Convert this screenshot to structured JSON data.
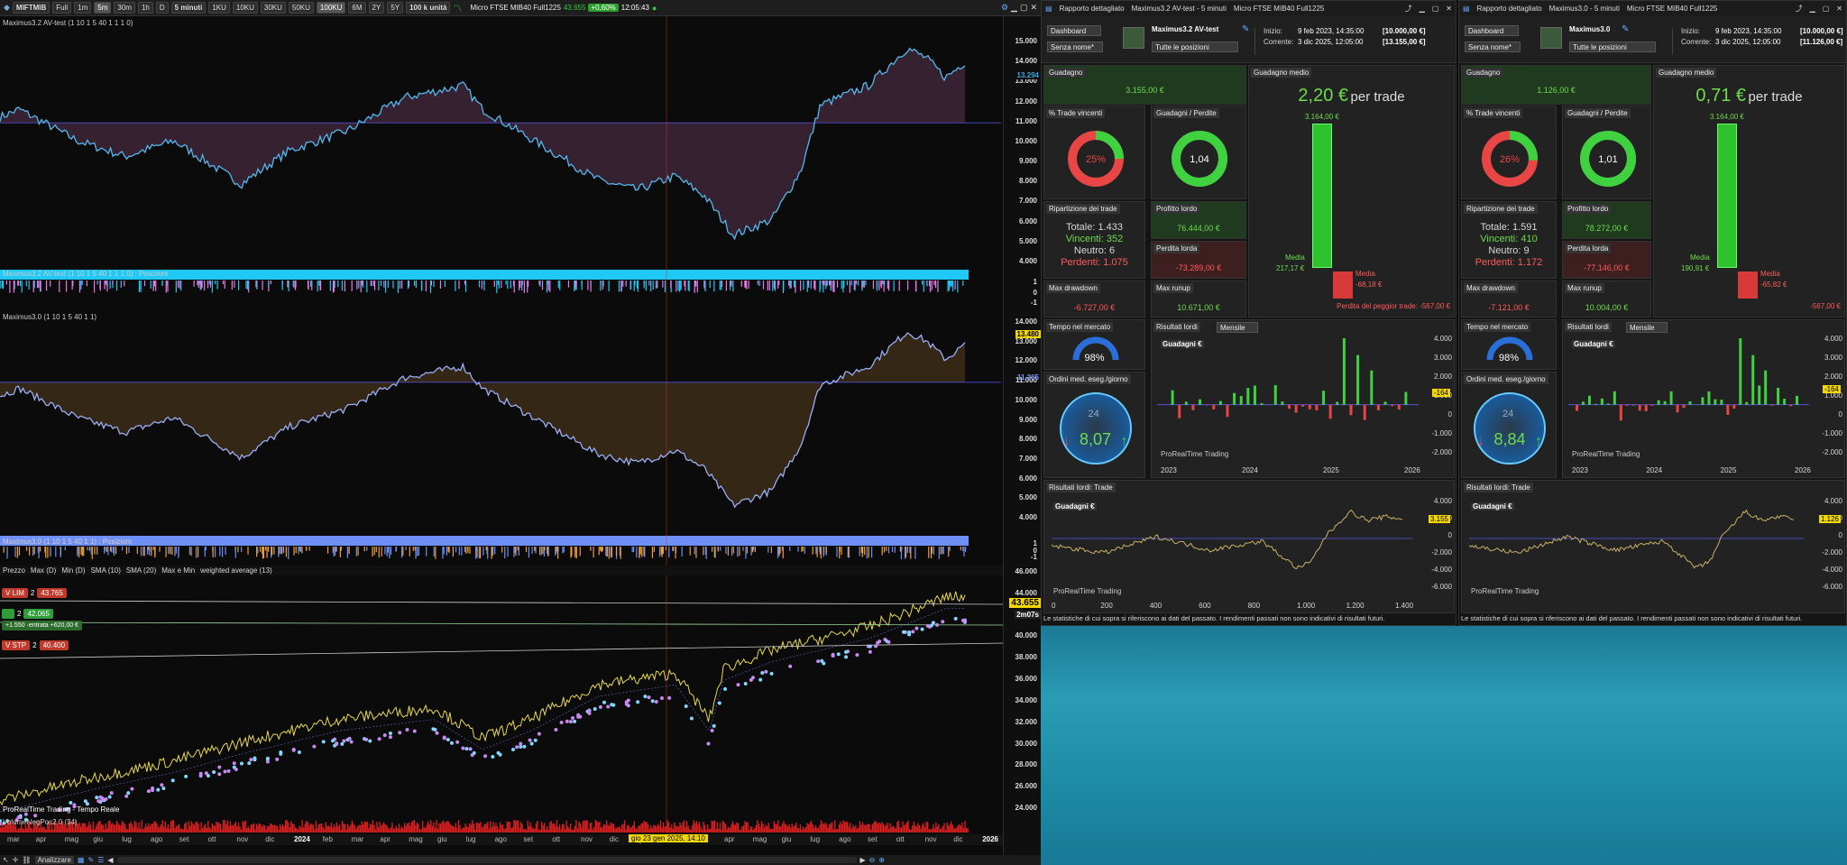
{
  "toolbar": {
    "symbol": "MIFTMIB",
    "full": "Full",
    "tf_buttons": [
      "1m",
      "5m",
      "30m",
      "1h",
      "D"
    ],
    "interval": "5 minuti",
    "range_buttons": [
      "1KU",
      "10KU",
      "30KU",
      "50KU",
      "100KU",
      "6M",
      "2Y",
      "5Y"
    ],
    "units": "100 k unità",
    "instrument": "Micro FTSE MIB40 Full1225",
    "price": "43.655",
    "change": "+0,60%",
    "time": "12:05:43"
  },
  "colors": {
    "cyan": "#00bfff",
    "violet": "#b066c8",
    "orange": "#e89a2a",
    "periwinkle": "#7d9cff",
    "yellow": "#e8d84a",
    "green": "#3fd13f",
    "red": "#e03030"
  },
  "panels": {
    "p1_label": "Maximus3.2 AV-test (1 10 1 5 40 1 1 1 0)",
    "p1_pos_label": "Maximus3.2 AV-test (1 10 1 5 40 1 1 1 0) : Posizioni",
    "p2_label": "Maximus3.0 (1 10 1 5 40 1 1)",
    "p2_pos_label": "Maximus3.0 (1 10 1 5 40 1 1) : Posizioni",
    "price_indicators": [
      "Prezzo",
      "Max (D)",
      "Min (D)",
      "SMA (10)",
      "SMA (20)",
      "Max e Min",
      "weighted average (13)"
    ],
    "vol_label": "VolumeNegPos2.0 (34)",
    "watermark": "ProRealTime Trading - Tempo Reale"
  },
  "axes": {
    "p1": [
      "15.000",
      "14.000",
      "13.000",
      "12.000",
      "11.000",
      "10.000",
      "9.000",
      "8.000",
      "7.000",
      "6.000",
      "5.000",
      "4.000"
    ],
    "p1_cur": "13.294",
    "pos1": [
      "1",
      "0",
      "-1"
    ],
    "p2": [
      "14.000",
      "13.000",
      "12.000",
      "11.000",
      "10.000",
      "9.000",
      "8.000",
      "7.000",
      "6.000",
      "5.000",
      "4.000"
    ],
    "p2_cur": "13.480",
    "p2_cur2": "11.265",
    "pos2": [
      "1",
      "0",
      "-1"
    ],
    "price": [
      "46.000",
      "44.000",
      "42.000",
      "40.000",
      "38.000",
      "36.000",
      "34.000",
      "32.000",
      "30.000",
      "28.000",
      "26.000",
      "24.000"
    ],
    "price_cur": "43.655",
    "price_timer": "2m07s"
  },
  "orders": [
    {
      "tag": "V LIM",
      "qty": "2",
      "price": "43.765"
    },
    {
      "tag": "",
      "qty": "2",
      "price": "42.065",
      "pnl": "+1.550 ·entrata +620,00 €"
    },
    {
      "tag": "V STP",
      "qty": "2",
      "price": "40.400"
    }
  ],
  "months": [
    "mar",
    "apr",
    "mag",
    "giu",
    "lug",
    "ago",
    "set",
    "ott",
    "nov",
    "dic",
    "2024",
    "feb",
    "mar",
    "apr",
    "mag",
    "giu",
    "lug",
    "ago",
    "set",
    "ott",
    "nov",
    "dic",
    "gen",
    "feb",
    "mar",
    "apr",
    "mag",
    "giu",
    "lug",
    "ago",
    "set",
    "ott",
    "nov",
    "dic",
    "2026"
  ],
  "date_highlight": "gio 23 gen 2025, 14:10",
  "bottom": {
    "analyze": "Analizzare"
  },
  "reports": [
    {
      "title": "Rapporto dettagliato",
      "system": "Maximus3.2 AV-test - 5 minuti",
      "instr": "Micro FTSE MIB40 Full1225",
      "dash": "Dashboard",
      "noname": "Senza nome*",
      "sysname": "Maximus3.2 AV-test",
      "allpos": "Tutte le posizioni",
      "start_lbl": "Inizio:",
      "start": "9 feb 2023, 14:35:00",
      "start_cap": "[10.000,00 €]",
      "cur_lbl": "Corrente:",
      "cur": "3 dic 2025, 12:05:00",
      "cur_cap": "[13.155,00 €]",
      "gain_lbl": "Guadagno",
      "gain": "3.155,00 €",
      "avg_lbl": "Guadagno medio",
      "avg": "2,20 €",
      "per_trade": "per trade",
      "win_lbl": "% Trade vincenti",
      "win": "25%",
      "win_frac": 0.25,
      "gl_lbl": "Guadagni / Perdite",
      "gl": "1,04",
      "gl_frac": 0.51,
      "bar_top": "3.164,00 €",
      "media_win": "Media",
      "media_win_v": "217,17 €",
      "media_loss": "Media",
      "media_loss_v": "-68,18 €",
      "worst": "Perdita del peggior trade: -567,00 €",
      "rip_lbl": "Ripartizione dei trade",
      "total": "Totale: 1.433",
      "wins": "Vincenti: 352",
      "neutral": "Neutro: 6",
      "losses": "Perdenti: 1.075",
      "gross_p_lbl": "Profitto lordo",
      "gross_p": "76.444,00 €",
      "gross_l_lbl": "Perdita lorda",
      "gross_l": "-73.289,00 €",
      "dd_lbl": "Max drawdown",
      "dd": "-6.727,00 €",
      "ru_lbl": "Max runup",
      "ru": "10.671,00 €",
      "tm_lbl": "Tempo nel mercato",
      "tm": "98%",
      "ord_lbl": "Ordini med. eseg./giorno",
      "ord": "8,07",
      "gauge_top": "24",
      "res_lbl": "Risultati lordi",
      "res_sel": "Mensile",
      "res_y": [
        "4.000",
        "3.000",
        "2.000",
        "1.000",
        "0",
        "-1.000",
        "-2.000"
      ],
      "res_years": [
        "2023",
        "2024",
        "2025",
        "2026"
      ],
      "res_badge": "-164",
      "gains_lbl": "Guadagni €",
      "prt": "ProRealTime Trading",
      "trade_lbl": "Risultati lordi: Trade",
      "trade_y": [
        "4.000",
        "2.000",
        "0",
        "-2.000",
        "-4.000",
        "-6.000"
      ],
      "trade_badge": "3.155",
      "trade_x": [
        "0",
        "200",
        "400",
        "600",
        "800",
        "1.000",
        "1.200",
        "1.400"
      ],
      "foot": "Le statistiche di cui sopra si riferiscono ai dati del passato. I rendimenti passati non sono indicativi di risultati futuri."
    },
    {
      "title": "Rapporto dettagliato",
      "system": "Maximus3.0 - 5 minuti",
      "instr": "Micro FTSE MIB40 Full1225",
      "dash": "Dashboard",
      "noname": "Senza nome*",
      "sysname": "Maximus3.0",
      "allpos": "Tutte le posizioni",
      "start_lbl": "Inizio:",
      "start": "9 feb 2023, 14:35:00",
      "start_cap": "[10.000,00 €]",
      "cur_lbl": "Corrente:",
      "cur": "3 dic 2025, 12:05:00",
      "cur_cap": "[11.126,00 €]",
      "gain_lbl": "Guadagno",
      "gain": "1.126,00 €",
      "avg_lbl": "Guadagno medio",
      "avg": "0,71 €",
      "per_trade": "per trade",
      "win_lbl": "% Trade vincenti",
      "win": "26%",
      "win_frac": 0.26,
      "gl_lbl": "Guadagni / Perdite",
      "gl": "1,01",
      "gl_frac": 0.5,
      "bar_top": "3.164,00 €",
      "media_win": "Media",
      "media_win_v": "190,91 €",
      "media_loss": "Media",
      "media_loss_v": "-65,82 €",
      "worst": "-567,00 €",
      "rip_lbl": "Ripartizione dei trade",
      "total": "Totale: 1.591",
      "wins": "Vincenti: 410",
      "neutral": "Neutro: 9",
      "losses": "Perdenti: 1.172",
      "gross_p_lbl": "Profitto lordo",
      "gross_p": "78.272,00 €",
      "gross_l_lbl": "Perdita lorda",
      "gross_l": "-77.146,00 €",
      "dd_lbl": "Max drawdown",
      "dd": "-7.121,00 €",
      "ru_lbl": "Max runup",
      "ru": "10.004,00 €",
      "tm_lbl": "Tempo nel mercato",
      "tm": "98%",
      "ord_lbl": "Ordini med. eseg./giorno",
      "ord": "8,84",
      "gauge_top": "24",
      "res_lbl": "Risultati lordi",
      "res_sel": "Mensile",
      "res_y": [
        "4.000",
        "3.000",
        "2.000",
        "1.000",
        "0",
        "-1.000",
        "-2.000"
      ],
      "res_years": [
        "2023",
        "2024",
        "2025",
        "2026"
      ],
      "res_badge": "-164",
      "gains_lbl": "Guadagni €",
      "prt": "ProRealTime Trading",
      "trade_lbl": "Risultati lordi: Trade",
      "trade_y": [
        "4.000",
        "2.000",
        "0",
        "-2.000",
        "-4.000",
        "-6.000"
      ],
      "trade_badge": "1.126",
      "trade_x": [],
      "foot": "Le statistiche di cui sopra si riferiscono ai dati del passato. I rendimenti passati non sono indicativi di risultati futuri."
    }
  ]
}
